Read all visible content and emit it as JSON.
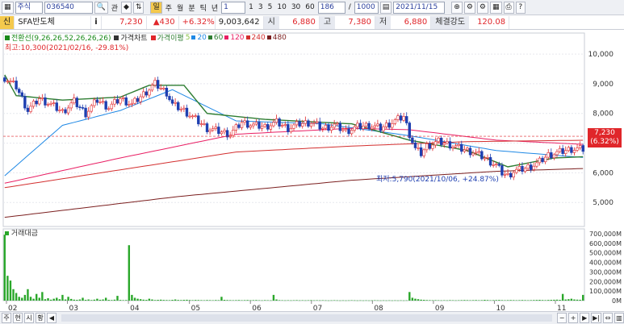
{
  "toolbar": {
    "market_select": "주식",
    "code": "036540",
    "btn_search": "관",
    "btn_nav": "◆",
    "period_buttons": [
      "주",
      "월",
      "분",
      "틱",
      "년"
    ],
    "interval_select": "1",
    "minute_buttons": [
      "1",
      "3",
      "5",
      "10",
      "30",
      "60"
    ],
    "count_value": "186",
    "max_count": "1000",
    "date_value": "2021/11/15"
  },
  "quote": {
    "badge": "신",
    "name": "SFA반도체",
    "info_icon": "i",
    "price": "7,230",
    "change": "▲430",
    "change_pct": "+6.32%",
    "volume": "9,003,642",
    "open_label": "시",
    "open": "6,880",
    "high_label": "고",
    "high": "7,380",
    "low_label": "저",
    "low": "6,880",
    "strength_label": "체결강도",
    "strength": "120.08"
  },
  "legend": {
    "ichimoku": "전환선(9,26,26,52,26,26,26)",
    "price_chart": "가격차트",
    "ma_label": "가격이평",
    "ma_periods": [
      "5",
      "20",
      "60",
      "120",
      "240",
      "480"
    ],
    "max_note": "최고:10,300(2021/02/16, -29.81%)",
    "min_note": "최저:5,790(2021/10/06, +24.87%)",
    "volume_label": "거래대금"
  },
  "price_badge": {
    "line1": "7,230",
    "line2": "(6.32%)"
  },
  "colors": {
    "up": "#e0262a",
    "down": "#1f3fb0",
    "ma5": "#8bc34a",
    "ma20": "#1e88e5",
    "ma60": "#2e7d32",
    "ma120": "#e91e63",
    "ma240": "#d32f2f",
    "ma480": "#7b1f1f",
    "ichimoku": "#1b8a1b",
    "volume": "#2aa72a"
  },
  "chart_data": {
    "type": "candlestick",
    "y_ticks": [
      "10,000",
      "9,000",
      "8,000",
      "7,000",
      "6,000",
      "5,000"
    ],
    "y_values": [
      10000,
      9000,
      8000,
      7000,
      6000,
      5000
    ],
    "ylim": [
      4300,
      10600
    ],
    "x_labels": [
      "02",
      "03",
      "04",
      "05",
      "06",
      "07",
      "08",
      "09",
      "10",
      "11"
    ],
    "volume_ticks": [
      "700,000M",
      "600,000M",
      "500,000M",
      "400,000M",
      "300,000M",
      "200,000M",
      "100,000M",
      "0M"
    ],
    "volume_values": [
      700000,
      600000,
      500000,
      400000,
      300000,
      200000,
      100000,
      0
    ],
    "close_path": [
      [
        0,
        9200
      ],
      [
        4,
        8900
      ],
      [
        8,
        8100
      ],
      [
        12,
        8500
      ],
      [
        16,
        8300
      ],
      [
        20,
        8050
      ],
      [
        24,
        8400
      ],
      [
        28,
        8000
      ],
      [
        32,
        8450
      ],
      [
        36,
        8200
      ],
      [
        40,
        8500
      ],
      [
        44,
        8300
      ],
      [
        48,
        8650
      ],
      [
        52,
        9000
      ],
      [
        56,
        8700
      ],
      [
        58,
        8300
      ],
      [
        62,
        8100
      ],
      [
        66,
        7800
      ],
      [
        70,
        7500
      ],
      [
        74,
        7400
      ],
      [
        78,
        7300
      ],
      [
        82,
        7700
      ],
      [
        86,
        7600
      ],
      [
        90,
        7550
      ],
      [
        94,
        7700
      ],
      [
        98,
        7500
      ],
      [
        102,
        7650
      ],
      [
        106,
        7700
      ],
      [
        110,
        7500
      ],
      [
        114,
        7600
      ],
      [
        118,
        7400
      ],
      [
        122,
        7550
      ],
      [
        126,
        7600
      ],
      [
        130,
        7500
      ],
      [
        134,
        7700
      ],
      [
        138,
        7900
      ],
      [
        140,
        7300
      ],
      [
        142,
        6800
      ],
      [
        144,
        6650
      ],
      [
        146,
        6900
      ],
      [
        150,
        7050
      ],
      [
        154,
        6950
      ],
      [
        158,
        6800
      ],
      [
        162,
        6700
      ],
      [
        166,
        6500
      ],
      [
        170,
        6250
      ],
      [
        172,
        6000
      ],
      [
        174,
        5900
      ],
      [
        176,
        6050
      ],
      [
        180,
        6150
      ],
      [
        184,
        6300
      ],
      [
        188,
        6600
      ],
      [
        192,
        6700
      ],
      [
        196,
        6800
      ],
      [
        200,
        6800
      ],
      [
        202,
        7230
      ]
    ],
    "ma_paths": {
      "ma20": [
        [
          0,
          5900
        ],
        [
          20,
          7600
        ],
        [
          40,
          8100
        ],
        [
          58,
          8800
        ],
        [
          80,
          7750
        ],
        [
          110,
          7650
        ],
        [
          140,
          7250
        ],
        [
          170,
          6750
        ],
        [
          202,
          6500
        ]
      ],
      "ma60": [
        [
          0,
          9300
        ],
        [
          4,
          8600
        ],
        [
          20,
          8450
        ],
        [
          40,
          8550
        ],
        [
          50,
          8950
        ],
        [
          62,
          8950
        ],
        [
          70,
          8000
        ],
        [
          90,
          7800
        ],
        [
          120,
          7650
        ],
        [
          140,
          7100
        ],
        [
          160,
          6750
        ],
        [
          174,
          6200
        ],
        [
          190,
          6500
        ],
        [
          202,
          6550
        ]
      ],
      "ma120": [
        [
          0,
          5650
        ],
        [
          40,
          6500
        ],
        [
          80,
          7300
        ],
        [
          120,
          7500
        ],
        [
          140,
          7450
        ],
        [
          170,
          7100
        ],
        [
          202,
          6950
        ]
      ],
      "ma240": [
        [
          0,
          5500
        ],
        [
          40,
          6100
        ],
        [
          80,
          6700
        ],
        [
          120,
          6900
        ],
        [
          160,
          7050
        ],
        [
          202,
          7100
        ]
      ],
      "ma480": [
        [
          0,
          4500
        ],
        [
          60,
          5200
        ],
        [
          120,
          5750
        ],
        [
          170,
          6050
        ],
        [
          202,
          6150
        ]
      ]
    },
    "volume_series": [
      690000,
      260000,
      210000,
      120000,
      80000,
      40000,
      30000,
      60000,
      120000,
      40000,
      20000,
      70000,
      30000,
      90000,
      15000,
      25000,
      10000,
      20000,
      30000,
      15000,
      60000,
      12000,
      40000,
      18000,
      10000,
      8000,
      12000,
      30000,
      8000,
      12000,
      6000,
      10000,
      20000,
      9000,
      12000,
      30000,
      8000,
      6000,
      10000,
      50000,
      7000,
      5000,
      6000,
      580000,
      60000,
      30000,
      20000,
      15000,
      10000,
      8000,
      20000,
      12000,
      6000,
      8000,
      10000,
      7000,
      6000,
      5000,
      8000,
      12000,
      7000,
      6000,
      8000,
      9000,
      6000,
      5000,
      7000,
      6000,
      5000,
      4000,
      6000,
      5000,
      4000,
      6000,
      5000,
      40000,
      8000,
      6000,
      5000,
      4000,
      5000,
      6000,
      4000,
      5000,
      6000,
      4000,
      5000,
      6000,
      4000,
      3000,
      5000,
      4000,
      3000,
      60000,
      12000,
      5000,
      4000,
      3000,
      4000,
      3000,
      4000,
      5000,
      3000,
      4000,
      3000,
      4000,
      5000,
      3000,
      4000,
      3000,
      4000,
      3000,
      2000,
      3000,
      4000,
      3000,
      2000,
      3000,
      2000,
      3000,
      4000,
      3000,
      2000,
      3000,
      2000,
      3000,
      2000,
      3000,
      4000,
      3000,
      2000,
      3000,
      2000,
      3000,
      2000,
      3000,
      2000,
      3000,
      2000,
      3000,
      90000,
      30000,
      20000,
      15000,
      10000,
      8000,
      6000,
      5000,
      4000,
      5000,
      4000,
      3000,
      4000,
      3000,
      5000,
      4000,
      3000,
      4000,
      5000,
      6000,
      5000,
      4000,
      5000,
      6000,
      4000,
      5000,
      8000,
      6000,
      4000,
      5000,
      6000,
      7000,
      5000,
      4000,
      5000,
      6000,
      5000,
      4000,
      5000,
      6000,
      5000,
      4000,
      5000,
      6000,
      7000,
      8000,
      6000,
      5000,
      7000,
      8000,
      9000,
      10000,
      8000,
      70000,
      12000,
      15000,
      20000,
      12000,
      10000,
      9000,
      60000
    ]
  },
  "bottom_bar": {
    "buttons": [
      "주",
      "현",
      "시",
      "황"
    ]
  }
}
